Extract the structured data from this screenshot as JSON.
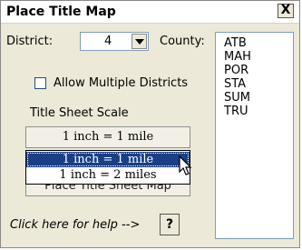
{
  "window": {
    "title": "Place Title Map",
    "close_label": "X"
  },
  "district": {
    "label": "District:",
    "value": "4"
  },
  "county": {
    "label": "County:",
    "items": [
      "ATB",
      "MAH",
      "POR",
      "STA",
      "SUM",
      "TRU"
    ]
  },
  "allow_multiple": {
    "label": "Allow Multiple Districts",
    "checked": false
  },
  "scale": {
    "label": "Title Sheet Scale",
    "selected": "1 inch = 1 mile",
    "options": [
      "1 inch = 1 mile",
      "1 inch = 2 miles"
    ],
    "highlighted_option": "1 inch = 1 mile"
  },
  "place_button": {
    "label": "Place Title Sheet Map"
  },
  "help": {
    "text": "Click here for help -->",
    "button_label": "?"
  }
}
